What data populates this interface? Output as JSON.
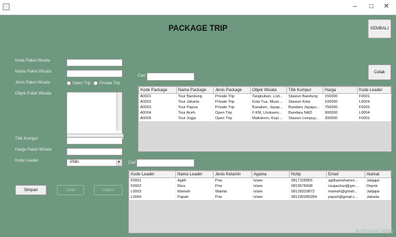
{
  "window": {
    "minimize": "–",
    "maximize": "□",
    "close": "✕"
  },
  "header": {
    "title": "PACKAGE TRIP",
    "back_label": "KEMBALI"
  },
  "form": {
    "kode_paket_label": "Kode Paket Wisata",
    "nama_paket_label": "Nama Paket Wisata",
    "jenis_paket_label": "Jenis Paket Wisata",
    "open_trip_label": "Open Trip",
    "private_trip_label": "Private Trip",
    "objek_label": "Objek Paket Wisata",
    "titik_kumpul_label": "Titik Kumpul",
    "harga_label": "Harga Paket Wisata",
    "kode_leader_label": "Kode Leader",
    "kode_leader_value": "-Pilih-"
  },
  "buttons": {
    "simpan": "Simpan",
    "ubah": "Ubah",
    "hapus": "Hapus",
    "cetak": "Cetak"
  },
  "search1": {
    "label": "Cari :"
  },
  "search2": {
    "label": "Cari :"
  },
  "package_table": {
    "columns": [
      "Kode Package",
      "Nama Package",
      "Jenis Package",
      "Objek Wisata",
      "Titik Kumpul",
      "Harga",
      "Kode Leader"
    ],
    "rows": [
      [
        "A0001",
        "Tour Bandung",
        "Private Trip",
        "Tangkuban, Lod...",
        "Stasiun Bandung",
        "150000",
        "F0001"
      ],
      [
        "A0002",
        "Tour Jakarta",
        "Private Trip",
        "Kota Tua, Muse...",
        "Stasiun Kota",
        "100000",
        "L0004"
      ],
      [
        "A0003",
        "Tour Papua",
        "Private Trip",
        "Bunaken, Jayap...",
        "Bandara Jayapu...",
        "750000",
        "F0002"
      ],
      [
        "A0004",
        "Tour Aceh",
        "Open Trip",
        "0 KM, Lhoksem...",
        "Bandara NAD",
        "900000",
        "L0004"
      ],
      [
        "A0005",
        "Tour Jogja",
        "Open Trip",
        "Malioboro, Kopi ...",
        "Stasiun Lempuy...",
        "300000",
        "F0001"
      ]
    ]
  },
  "leader_table": {
    "columns": [
      "Kode Leader",
      "Nama Leader",
      "Jenis Kelamin",
      "Agama",
      "Nohp",
      "Email",
      "Alamat"
    ],
    "rows": [
      [
        "F0001",
        "Agith",
        "Pria",
        "Islam",
        "0817105865",
        "agithamohamm...",
        "Jatijajar"
      ],
      [
        "F0002",
        "Riza",
        "Pria",
        "Islam",
        "0819578498",
        "rizajauhari@gm...",
        "Depok"
      ],
      [
        "L0003",
        "Mamah",
        "Wanita",
        "Islam",
        "08128329872",
        "mamah@gmail...",
        "Jatijajar"
      ],
      [
        "L0004",
        "Papah",
        "Pria",
        "Islam",
        "081290280284",
        "papah@gmail.c...",
        "Jakarta"
      ]
    ]
  },
  "watermark": "Activate Win"
}
